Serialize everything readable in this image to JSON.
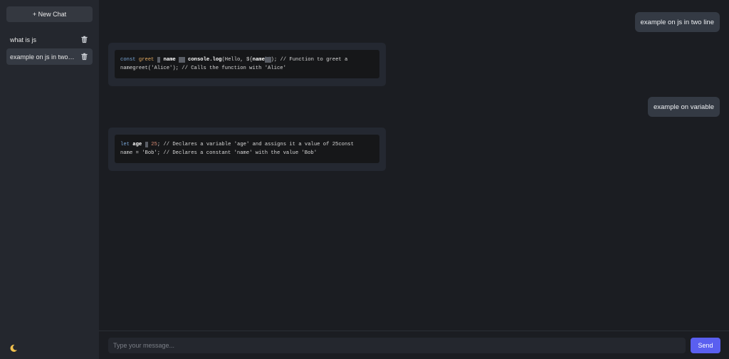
{
  "sidebar": {
    "new_chat_label": "+ New Chat",
    "chats": [
      {
        "label": "what is js",
        "active": false
      },
      {
        "label": "example on js in two line",
        "active": true
      }
    ],
    "theme_icon": "moon-icon"
  },
  "messages": [
    {
      "role": "user",
      "text": "example on js in two line"
    },
    {
      "role": "assistant",
      "code": {
        "l1_kw": "const",
        "l1_fn": "greet",
        "l1_name": "name",
        "l1_log": "console.log",
        "l1_hello": "(Hello, ${",
        "l1_name2": "name",
        "l1_comment": "); // Function to greet a",
        "l2": "namegreet('Alice'); // Calls the function with 'Alice'"
      }
    },
    {
      "role": "user",
      "text": "example on variable"
    },
    {
      "role": "assistant",
      "code": {
        "l1_kw": "let",
        "l1_var": "age",
        "l1_num": "25",
        "l1_comment": "; // Declares a variable 'age' and assigns it a value of 25const",
        "l2": "name = 'Bob'; // Declares a constant 'name' with the value 'Bob'"
      }
    }
  ],
  "composer": {
    "placeholder": "Type your message...",
    "send_label": "Send"
  },
  "colors": {
    "accent": "#5a5ff0",
    "sidebar_bg": "#24272e",
    "main_bg": "#1b1d22"
  }
}
